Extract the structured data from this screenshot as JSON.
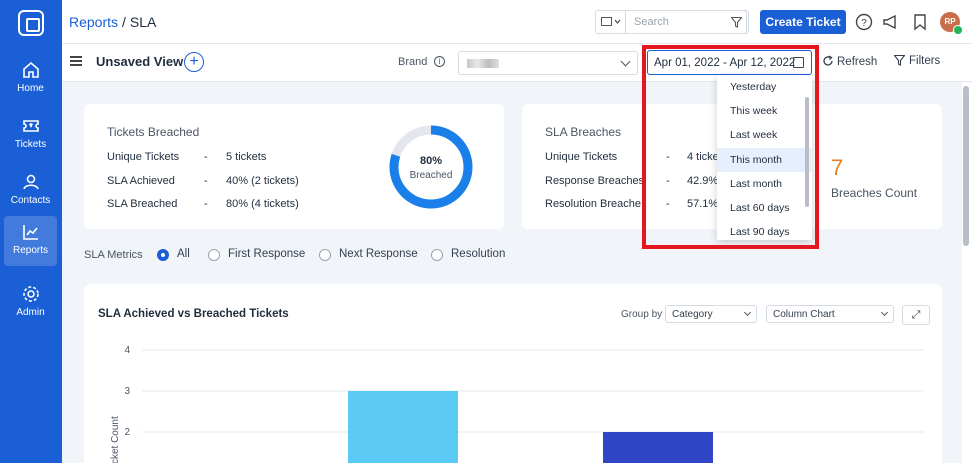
{
  "sidebar": {
    "items": [
      {
        "label": "Home",
        "icon": "home-icon"
      },
      {
        "label": "Tickets",
        "icon": "ticket-icon"
      },
      {
        "label": "Contacts",
        "icon": "contacts-icon"
      },
      {
        "label": "Reports",
        "icon": "reports-icon",
        "active": true
      },
      {
        "label": "Admin",
        "icon": "gear-icon"
      }
    ]
  },
  "header": {
    "breadcrumb_root": "Reports",
    "breadcrumb_sep": "/",
    "breadcrumb_current": "SLA",
    "search_placeholder": "Search",
    "create_label": "Create Ticket",
    "avatar_initials": "RP"
  },
  "toolbar": {
    "view_title": "Unsaved View",
    "add_symbol": "+",
    "brand_label": "Brand",
    "date_range": "Apr 01, 2022 - Apr 12, 2022",
    "refresh_label": "Refresh",
    "filters_label": "Filters"
  },
  "tickets_card": {
    "title": "Tickets Breached",
    "rows": [
      {
        "label": "Unique Tickets",
        "value": "5 tickets"
      },
      {
        "label": "SLA Achieved",
        "value": "40% (2 tickets)"
      },
      {
        "label": "SLA Breached",
        "value": "80% (4 tickets)"
      }
    ],
    "donut_pct": "80%",
    "donut_label": "Breached",
    "donut_fraction": 0.8
  },
  "breaches_card": {
    "title": "SLA Breaches",
    "rows": [
      {
        "label": "Unique Tickets",
        "value": "4 ticke"
      },
      {
        "label": "Response Breaches",
        "value": "42.9%"
      },
      {
        "label": "Resolution Breache",
        "value": "57.1%"
      }
    ],
    "count": "7",
    "count_label": "Breaches Count"
  },
  "metrics": {
    "label": "SLA Metrics",
    "options": [
      "All",
      "First Response",
      "Next Response",
      "Resolution"
    ],
    "selected": "All"
  },
  "chart_panel": {
    "title": "SLA Achieved vs Breached Tickets",
    "group_by_label": "Group by",
    "group_by_value": "Category",
    "chart_type_value": "Column Chart",
    "expand_symbol": "⤢"
  },
  "chart_data": {
    "type": "bar",
    "ylabel": "Ticket Count",
    "yticks": [
      4,
      3,
      2
    ],
    "ylim": [
      0,
      4
    ],
    "series": [
      {
        "color": "#5bcbf5",
        "values": [
          3
        ]
      },
      {
        "color": "#2f47c6",
        "values": [
          2
        ]
      }
    ]
  },
  "date_dropdown": {
    "options": [
      "Yesterday",
      "This week",
      "Last week",
      "This month",
      "Last month",
      "Last 60 days",
      "Last 90 days"
    ],
    "highlighted": "This month"
  },
  "colors": {
    "brand": "#1a5fd6",
    "accent_orange": "#e67e22",
    "highlight_red": "#e3171d"
  }
}
